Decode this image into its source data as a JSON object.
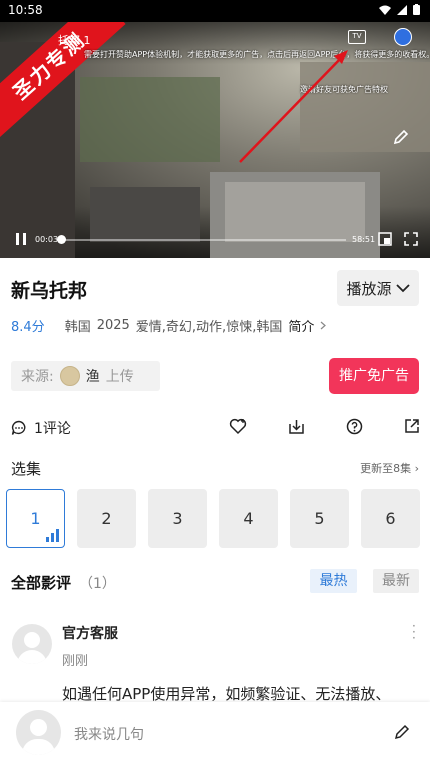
{
  "status_bar": {
    "time": "10:58"
  },
  "video": {
    "watermark": "圣力专测",
    "title": "托邦 1",
    "marquee": "需要打开赞助APP体验机制，才能获取更多的广告，点击后再返回APP后台，将获得更多的收看权。",
    "ad_tip": "邀请好友可获免广告特权",
    "tv_label": "TV",
    "current_time": "00:03",
    "total_time": "58:51",
    "progress_fraction": 0.01
  },
  "info": {
    "title": "新乌托邦",
    "source_selector_label": "播放源",
    "score": "8.4分",
    "region": "韩国",
    "year": "2025",
    "genres": "爱情,奇幻,动作,惊悚,韩国",
    "intro_label": "简介"
  },
  "uploader": {
    "prefix": "来源:",
    "name": "渔",
    "suffix": "上传"
  },
  "promo_button": "推广免广告",
  "actions": {
    "comment_count": "1评论"
  },
  "episodes": {
    "label": "选集",
    "update_info": "更新至8集",
    "items": [
      "1",
      "2",
      "3",
      "4",
      "5",
      "6"
    ],
    "active_index": 0
  },
  "reviews": {
    "label": "全部影评",
    "count": "（1）",
    "sort_hot": "最热",
    "sort_new": "最新",
    "items": [
      {
        "name": "官方客服",
        "time": "刚刚",
        "text": "如遇任何APP使用异常，如频繁验证、无法播放、"
      }
    ]
  },
  "bottom_bar": {
    "placeholder": "我来说几句"
  },
  "colors": {
    "accent": "#2f7bd8",
    "promo": "#f2355a",
    "watermark": "#e0141c"
  }
}
